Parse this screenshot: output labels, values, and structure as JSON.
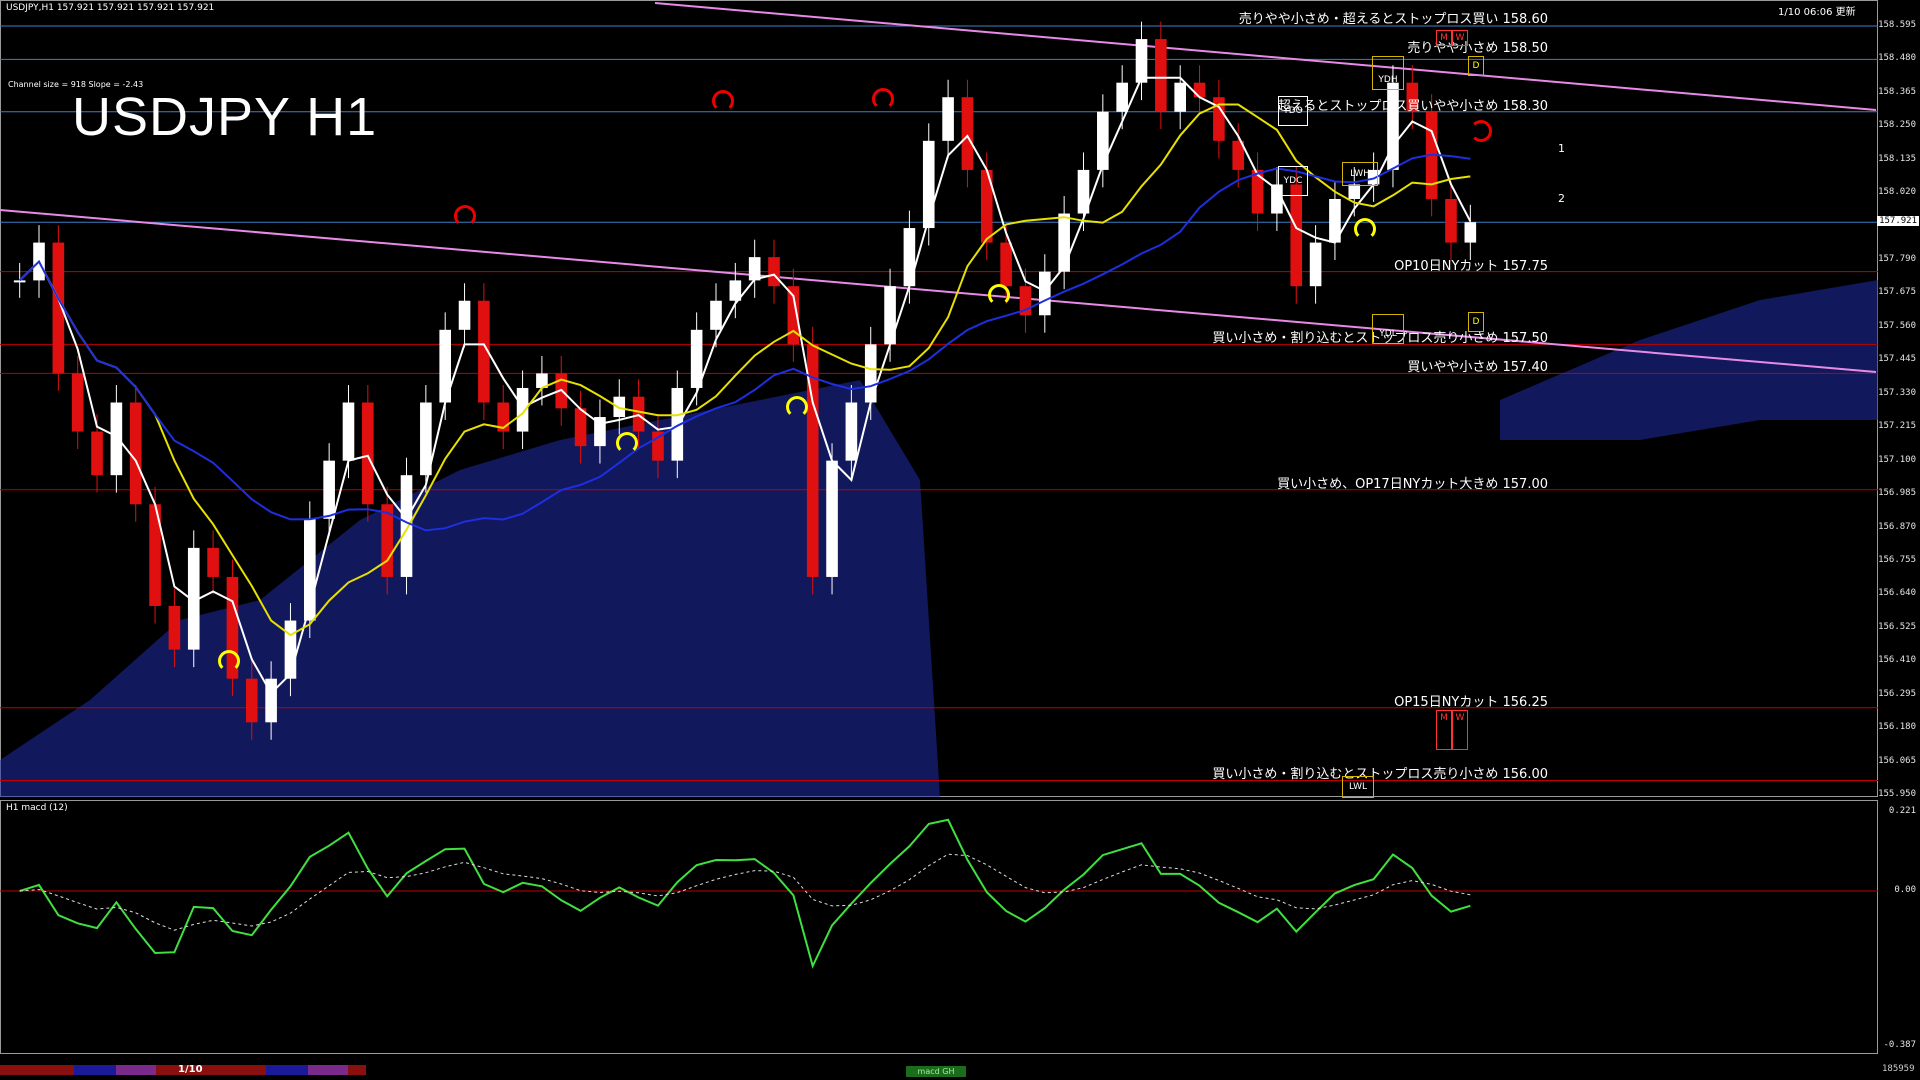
{
  "header": {
    "symbol_info": "USDJPY,H1  157.921 157.921 157.921 157.921",
    "update_time": "1/10 06:06 更新",
    "channel_note": "Channel size = 918 Slope = -2.43",
    "chart_title": "USDJPY H1"
  },
  "price_axis": {
    "ticks": [
      "158.595",
      "158.480",
      "158.365",
      "158.250",
      "158.135",
      "158.020",
      "157.790",
      "157.675",
      "157.560",
      "157.445",
      "157.330",
      "157.215",
      "157.100",
      "156.985",
      "156.870",
      "156.755",
      "156.640",
      "156.525",
      "156.410",
      "156.295",
      "156.180",
      "156.065",
      "155.950"
    ],
    "current_price": "157.921"
  },
  "annotations": [
    {
      "price": 158.6,
      "text": "売りやや小さめ・超えるとストップロス買い 158.60"
    },
    {
      "price": 158.5,
      "text": "売りやや小さめ 158.50"
    },
    {
      "price": 158.3,
      "text": "超えるとストップロス買いやや小さめ 158.30"
    },
    {
      "price": 157.75,
      "text": "OP10日NYカット 157.75"
    },
    {
      "price": 157.5,
      "text": "買い小さめ・割り込むとストップロス売り小さめ 157.50"
    },
    {
      "price": 157.4,
      "text": "買いやや小さめ 157.40"
    },
    {
      "price": 157.0,
      "text": "買い小さめ、OP17日NYカット大きめ 157.00"
    },
    {
      "price": 156.25,
      "text": "OP15日NYカット 156.25"
    },
    {
      "price": 156.0,
      "text": "買い小さめ・割り込むとストップロス売り小さめ 156.00"
    }
  ],
  "markers": {
    "ydh": "YDH",
    "ydo": "YDO",
    "ydc": "YDC",
    "ydl": "YDL",
    "lwh": "LWH",
    "lwl": "LWL",
    "m": "M",
    "w": "W",
    "d": "D",
    "line1": "1",
    "line2": "2"
  },
  "macd_panel": {
    "title": "H1  macd (12)",
    "axis_top": "0.221",
    "axis_zero": "0.00",
    "axis_bottom": "-0.387"
  },
  "status_bar": {
    "date": "1/10",
    "tag": "macd GH",
    "count": "185959"
  },
  "colors": {
    "background": "#000000",
    "ma_white": "#ffffff",
    "ma_yellow": "#e8e000",
    "ma_blue": "#1d2fe0",
    "channel_pink": "#e88ae8",
    "level_line_red": "#c00000",
    "level_line_blue": "#3b7fc4",
    "bull_candle": "#ffffff",
    "bear_candle": "#e01010",
    "macd_up": "#3fe03f",
    "macd_down": "#f08aa0",
    "kumo_blue": "#1f2ca8"
  },
  "chart_data": {
    "type": "candlestick",
    "y_range": [
      155.95,
      158.65
    ],
    "close_series": [
      157.72,
      157.85,
      157.4,
      157.2,
      157.05,
      157.3,
      156.95,
      156.6,
      156.45,
      156.8,
      156.7,
      156.35,
      156.2,
      156.35,
      156.55,
      156.9,
      157.1,
      157.3,
      156.95,
      156.7,
      157.05,
      157.3,
      157.55,
      157.65,
      157.3,
      157.2,
      157.35,
      157.4,
      157.28,
      157.15,
      157.25,
      157.32,
      157.2,
      157.1,
      157.35,
      157.55,
      157.65,
      157.72,
      157.8,
      157.7,
      157.5,
      156.7,
      157.1,
      157.3,
      157.5,
      157.7,
      157.9,
      158.2,
      158.35,
      158.1,
      157.85,
      157.7,
      157.6,
      157.75,
      157.95,
      158.1,
      158.3,
      158.4,
      158.55,
      158.3,
      158.4,
      158.35,
      158.2,
      158.1,
      157.95,
      158.05,
      157.7,
      157.85,
      158.0,
      158.05,
      158.1,
      158.4,
      158.3,
      158.0,
      157.85,
      157.92
    ]
  }
}
